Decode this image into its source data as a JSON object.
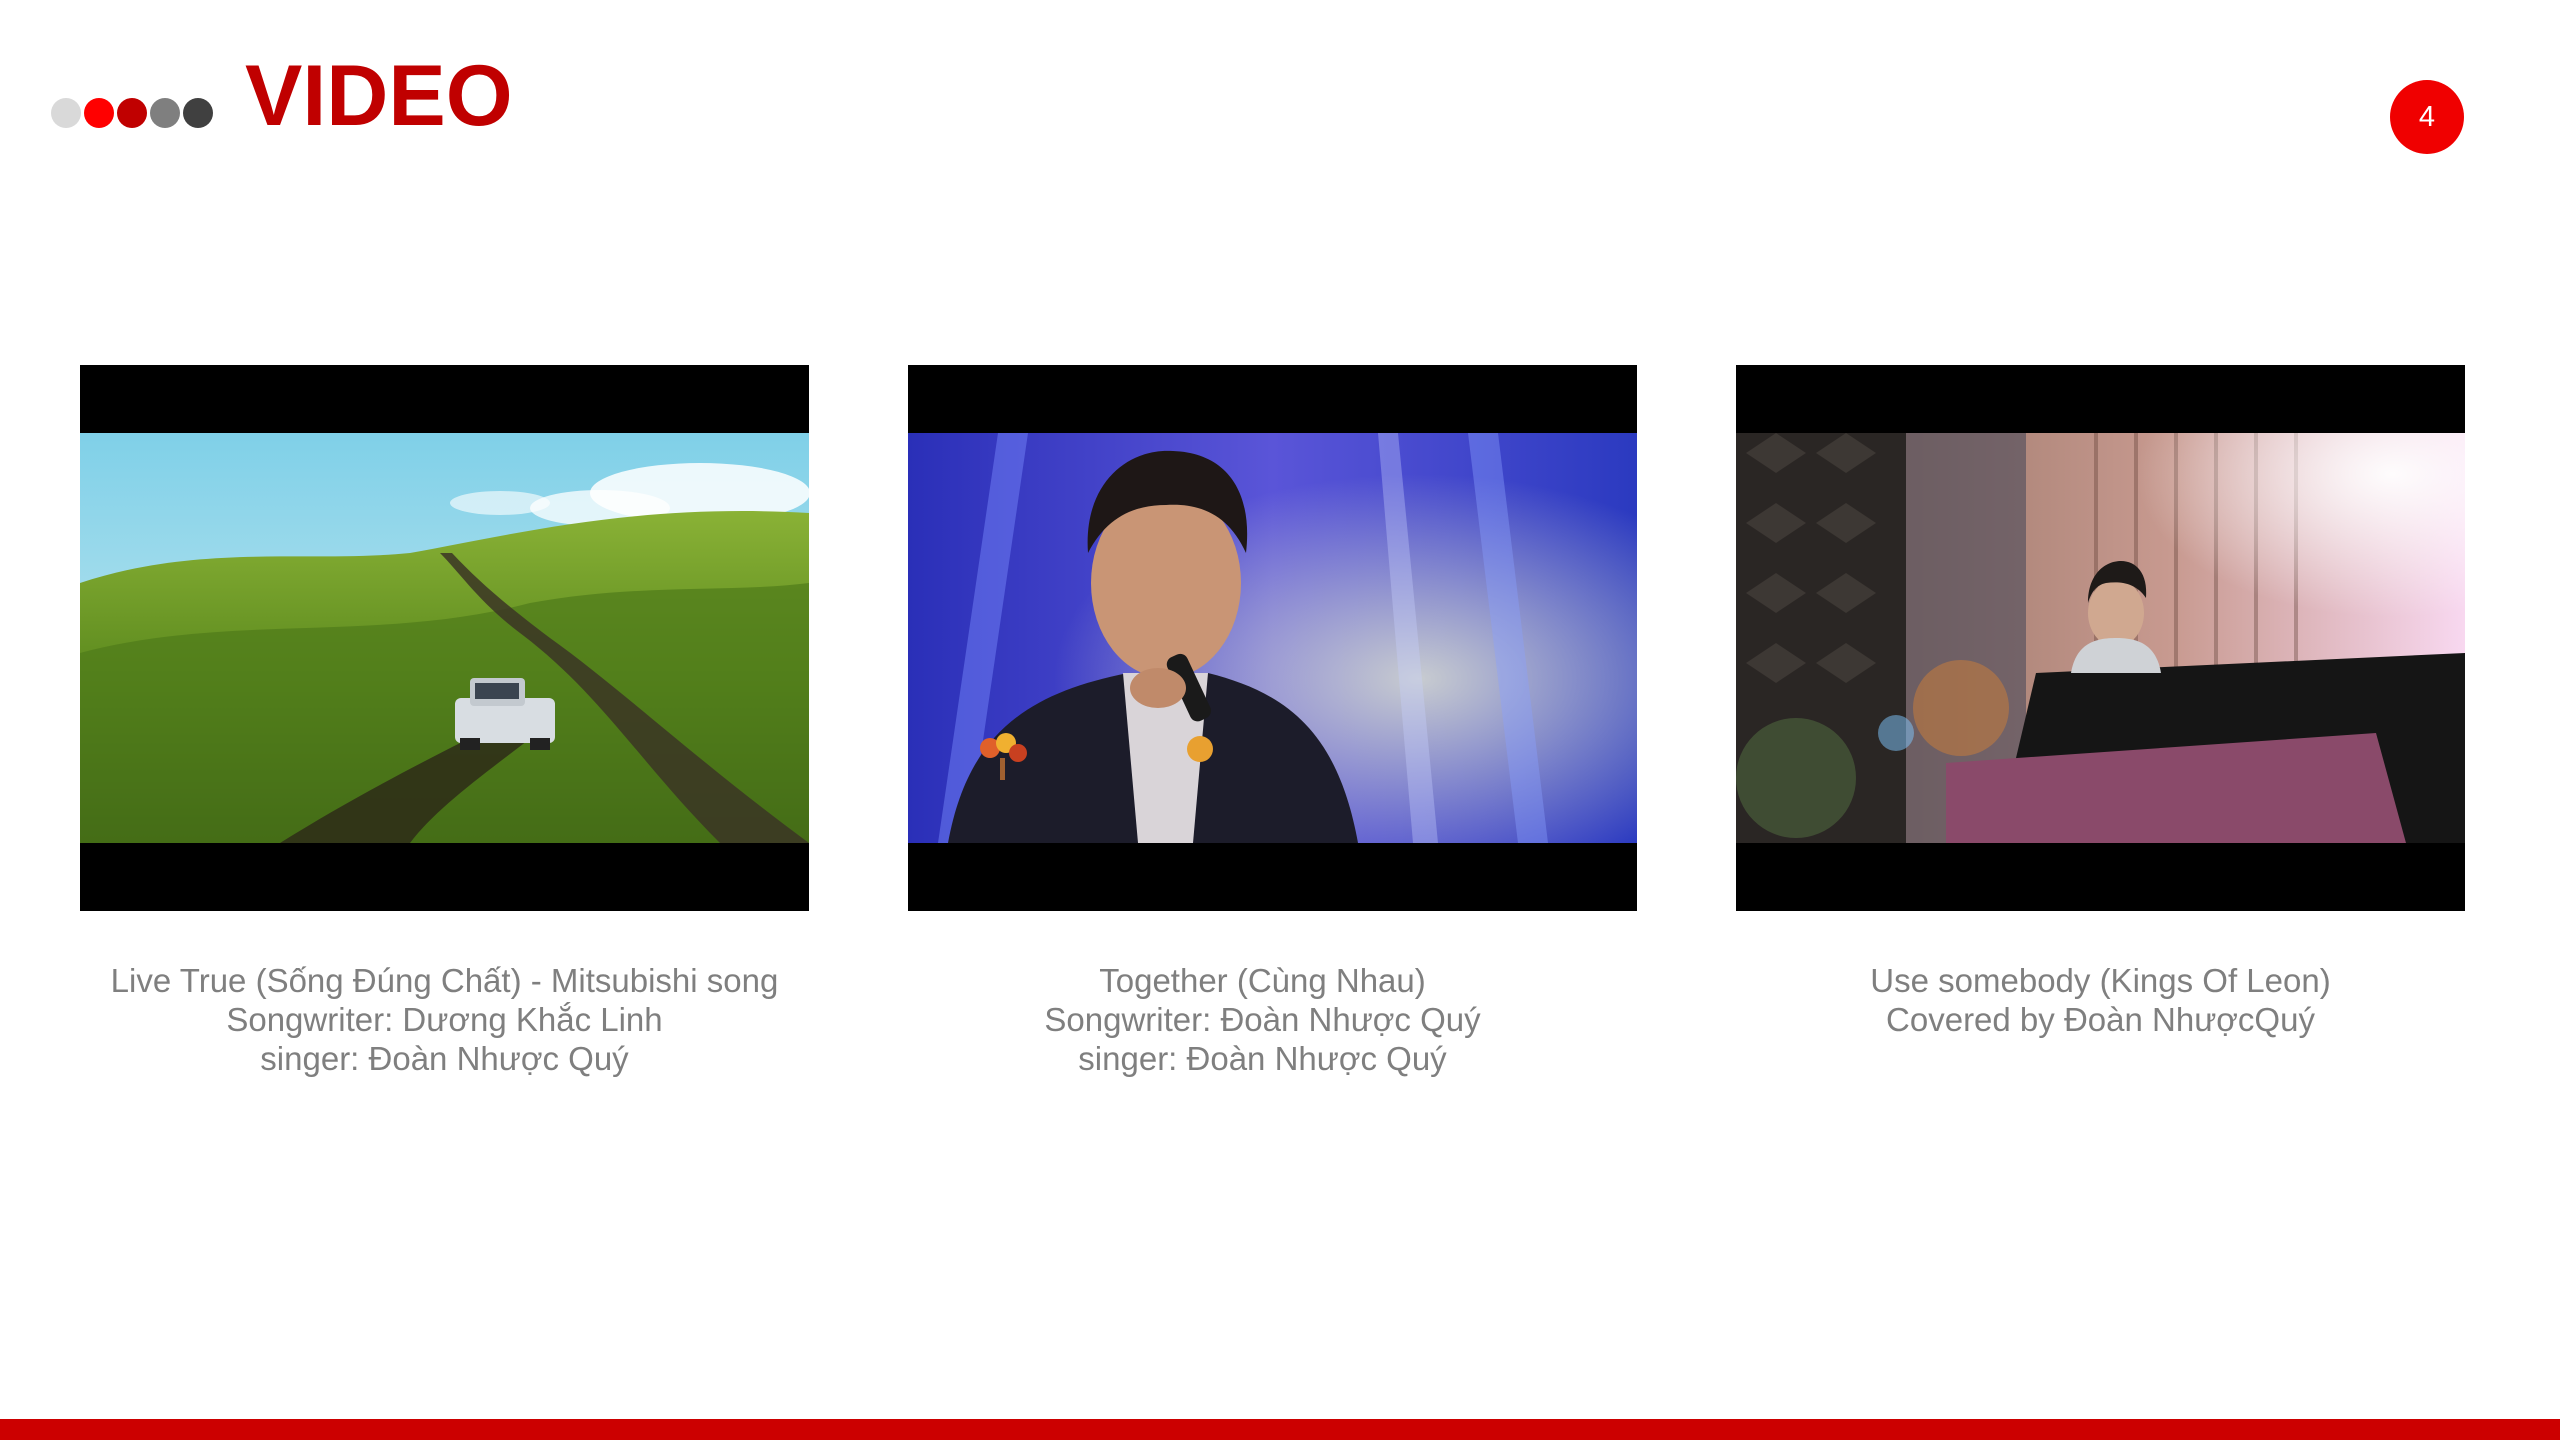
{
  "header": {
    "title": "VIDEO",
    "page_number": "4",
    "dot_colors": [
      "#d9d9d9",
      "#ff0000",
      "#c00000",
      "#7f7f7f",
      "#404040"
    ]
  },
  "videos": [
    {
      "thumbnail": "car-driving-on-green-hills",
      "lines": [
        "Live True (Sống Đúng Chất) - Mitsubishi song",
        "Songwriter: Dương Khắc Linh",
        "singer: Đoàn Nhược Quý"
      ]
    },
    {
      "thumbnail": "singer-on-stage-with-microphone",
      "lines": [
        "Together (Cùng Nhau)",
        "Songwriter: Đoàn Nhược Quý",
        "singer: Đoàn Nhược Quý"
      ]
    },
    {
      "thumbnail": "man-playing-piano-in-studio",
      "lines": [
        "Use somebody (Kings Of Leon)",
        "Covered by Đoàn NhượcQuý"
      ]
    }
  ],
  "colors": {
    "title": "#c00000",
    "badge": "#f00000",
    "caption_text": "#7f7f7f",
    "bottom_bar": "#cc0000"
  }
}
